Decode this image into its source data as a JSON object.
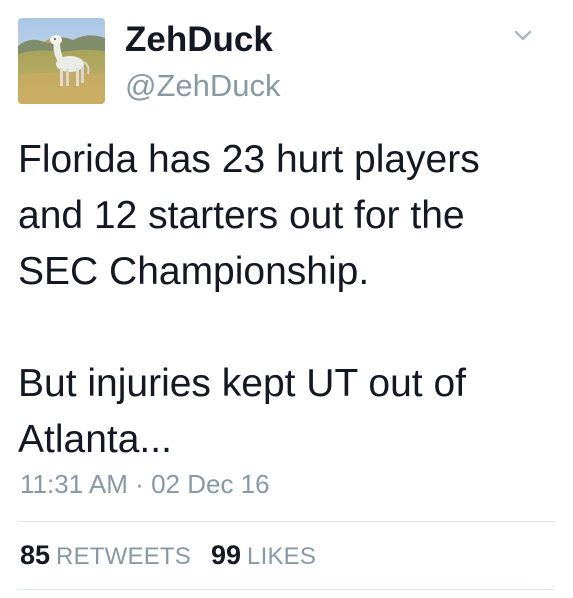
{
  "user": {
    "display_name": "ZehDuck",
    "handle": "@ZehDuck"
  },
  "tweet": {
    "text": "Florida has 23 hurt players\nand 12 starters out for the\nSEC Championship.\n\nBut injuries kept UT out of\nAtlanta...",
    "time": "11:31 AM",
    "separator": "·",
    "date": "02 Dec 16"
  },
  "stats": {
    "retweets_count": "85",
    "retweets_label": "RETWEETS",
    "likes_count": "99",
    "likes_label": "LIKES"
  },
  "icons": {
    "menu": "chevron-down-icon",
    "avatar": "avatar-duck-image"
  },
  "colors": {
    "text": "#141823",
    "secondary": "#8899a6",
    "divider": "#e1e8ed",
    "background": "#ffffff"
  }
}
